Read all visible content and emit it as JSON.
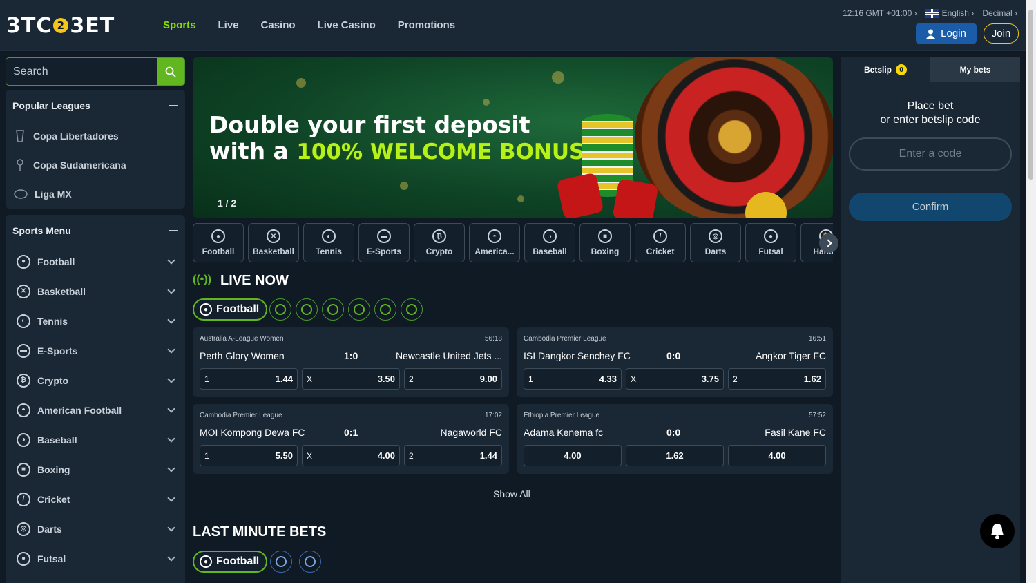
{
  "brand": {
    "logo_left": "3TC",
    "logo_mid": "2",
    "logo_right": "3ET"
  },
  "nav": [
    "Sports",
    "Live",
    "Casino",
    "Live Casino",
    "Promotions"
  ],
  "header": {
    "time": "12:16",
    "tz": "GMT +01:00",
    "language": "English",
    "odds_format": "Decimal",
    "login": "Login",
    "join": "Join"
  },
  "search": {
    "placeholder": "Search"
  },
  "popular_leagues": {
    "title": "Popular Leagues",
    "items": [
      "Copa Libertadores",
      "Copa Sudamericana",
      "Liga MX"
    ]
  },
  "sports_menu": {
    "title": "Sports Menu",
    "items": [
      "Football",
      "Basketball",
      "Tennis",
      "E-Sports",
      "Crypto",
      "American Football",
      "Baseball",
      "Boxing",
      "Cricket",
      "Darts",
      "Futsal"
    ]
  },
  "banner": {
    "line1": "Double your first deposit",
    "line2_prefix": "with a",
    "line2_highlight": "100% WELCOME BONUS",
    "page": "1 / 2"
  },
  "sport_tabs": [
    "Football",
    "Basketball",
    "Tennis",
    "E-Sports",
    "Crypto",
    "America...",
    "Baseball",
    "Boxing",
    "Cricket",
    "Darts",
    "Futsal",
    "Handb"
  ],
  "live": {
    "title": "LIVE NOW",
    "active_filter": "Football"
  },
  "matches": [
    {
      "league": "Australia A-League Women",
      "time": "56:18",
      "home": "Perth Glory Women",
      "score": "1:0",
      "away": "Newcastle United Jets ...",
      "odds": [
        {
          "k": "1",
          "v": "1.44"
        },
        {
          "k": "X",
          "v": "3.50"
        },
        {
          "k": "2",
          "v": "9.00"
        }
      ]
    },
    {
      "league": "Cambodia Premier League",
      "time": "16:51",
      "home": "ISI Dangkor Senchey FC",
      "score": "0:0",
      "away": "Angkor Tiger FC",
      "odds": [
        {
          "k": "1",
          "v": "4.33"
        },
        {
          "k": "X",
          "v": "3.75"
        },
        {
          "k": "2",
          "v": "1.62"
        }
      ]
    },
    {
      "league": "Cambodia Premier League",
      "time": "17:02",
      "home": "MOI Kompong Dewa FC",
      "score": "0:1",
      "away": "Nagaworld FC",
      "odds": [
        {
          "k": "1",
          "v": "5.50"
        },
        {
          "k": "X",
          "v": "4.00"
        },
        {
          "k": "2",
          "v": "1.44"
        }
      ]
    },
    {
      "league": "Ethiopia Premier League",
      "time": "57:52",
      "home": "Adama Kenema fc",
      "score": "0:0",
      "away": "Fasil Kane FC",
      "odds": [
        {
          "k": "",
          "v": "4.00"
        },
        {
          "k": "",
          "v": "1.62"
        },
        {
          "k": "",
          "v": "4.00"
        }
      ]
    }
  ],
  "show_all": "Show All",
  "last_minute": {
    "title": "LAST MINUTE BETS",
    "active_filter": "Football"
  },
  "betslip": {
    "tab_betslip": "Betslip",
    "count": "0",
    "tab_mybets": "My bets",
    "msg1": "Place bet",
    "msg2": "or enter betslip code",
    "code_placeholder": "Enter a code",
    "confirm": "Confirm"
  }
}
